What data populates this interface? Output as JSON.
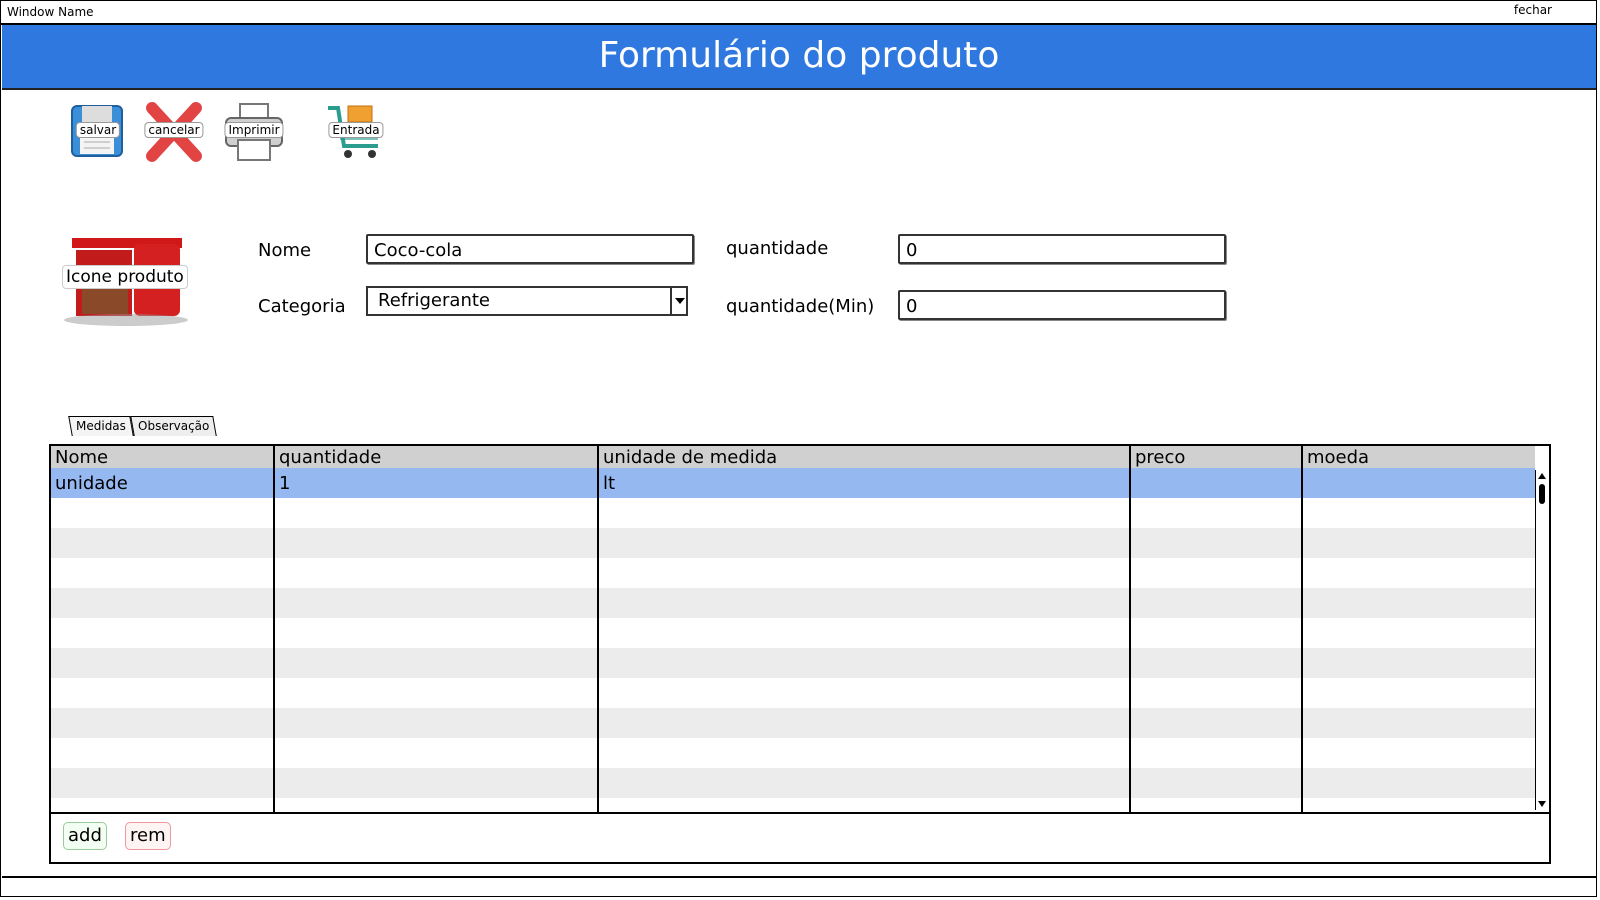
{
  "window": {
    "title": "Window Name",
    "close_label": "fechar"
  },
  "header": {
    "title": "Formulário do produto",
    "color": "#2f78e0"
  },
  "toolbar": {
    "save_label": "salvar",
    "cancel_label": "cancelar",
    "print_label": "Imprimir",
    "entry_label": "Entrada"
  },
  "product": {
    "image_label": "Icone produto",
    "image_icon": "product-cola-image"
  },
  "form": {
    "name_label": "Nome",
    "name_value": "Coco-cola",
    "category_label": "Categoria",
    "category_value": "Refrigerante",
    "quantity_label": "quantidade",
    "quantity_value": "0",
    "min_quantity_label": "quantidade(Min)",
    "min_quantity_value": "0"
  },
  "tabs": [
    {
      "label": "Medidas",
      "active": true
    },
    {
      "label": "Observação",
      "active": false
    }
  ],
  "table": {
    "columns": [
      "Nome",
      "quantidade",
      "unidade de medida",
      "preco",
      "moeda"
    ],
    "rows": [
      [
        "unidade",
        "1",
        "lt",
        "",
        ""
      ]
    ],
    "selected_color": "#96b8f0",
    "alt_row_color": "#ececec"
  },
  "grid_actions": {
    "add_label": "add",
    "remove_label": "rem"
  }
}
